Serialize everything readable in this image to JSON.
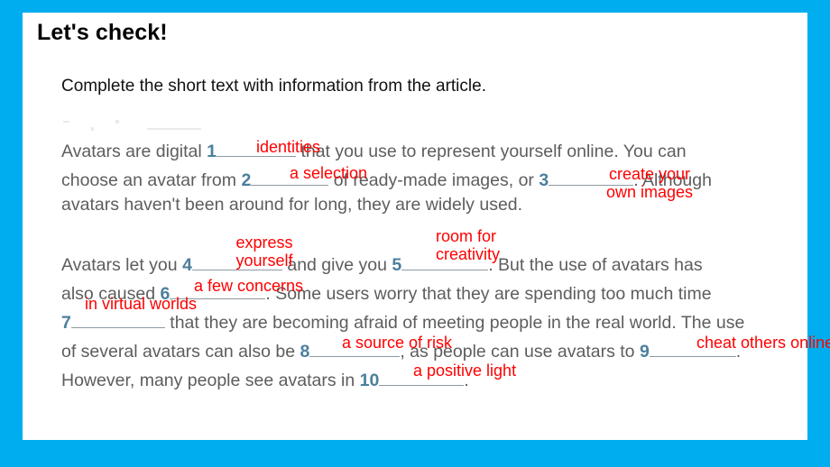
{
  "slide": {
    "title": "Let's check!",
    "instruction": "Complete the short text with information from the article.",
    "border_color": "#00AEEF",
    "answer_color": "#FF0000",
    "number_color": "#4B7F9D",
    "body_color": "#5D5D5D"
  },
  "passage": {
    "paragraph1_lines": [
      "Avatars are digital",
      "that you use to represent yourself online. You can",
      "choose an avatar from",
      "of ready-made images, or",
      ". Although",
      "avatars haven't been around for long, they are widely used."
    ],
    "paragraph2_lines": [
      "Avatars let you",
      "and give you",
      ". But the use of avatars has",
      "also caused",
      ". Some users worry that they are spending too much time",
      "that they are becoming afraid of meeting people in the real world. The use",
      "of several avatars can also be",
      ", as people can use avatars to",
      ".",
      "However, many people see avatars in",
      "."
    ],
    "line1_a": "Avatars are digital",
    "line1_b": "that you use to represent yourself online. You can",
    "line2_a": "choose an avatar from",
    "line2_b": "of ready-made images, or",
    "line2_c": ". Although",
    "line3": "avatars haven't been around for long, they are widely used.",
    "line4_a": "Avatars let you",
    "line4_b": "and give you",
    "line4_c": ". But the use of avatars has",
    "line5_a": "also caused",
    "line5_b": ". Some users worry that they are spending too much time",
    "line6_b": "that they are becoming afraid of meeting people in the real world. The use",
    "line7_a": "of several avatars can also be",
    "line7_b": ", as people can use avatars to",
    "line7_c": ".",
    "line8_a": "However, many people see avatars in",
    "line8_b": "."
  },
  "answers": [
    {
      "number": "1",
      "text": "identities"
    },
    {
      "number": "2",
      "text": "a selection"
    },
    {
      "number": "3",
      "text": "create your own images",
      "line1": "create your",
      "line2": "own images"
    },
    {
      "number": "4",
      "text": "express yourself",
      "line1": "express",
      "line2": "yourself"
    },
    {
      "number": "5",
      "text": "room for creativity",
      "line1": "room for",
      "line2": "creativity"
    },
    {
      "number": "6",
      "text": "a few concerns"
    },
    {
      "number": "7",
      "text": "in virtual worlds"
    },
    {
      "number": "8",
      "text": "a source of risk"
    },
    {
      "number": "9",
      "text": "cheat others online"
    },
    {
      "number": "10",
      "text": "a positive light"
    }
  ],
  "numbers": {
    "n1": "1",
    "n2": "2",
    "n3": "3",
    "n4": "4",
    "n5": "5",
    "n6": "6",
    "n7": "7",
    "n8": "8",
    "n9": "9",
    "n10": "10"
  }
}
